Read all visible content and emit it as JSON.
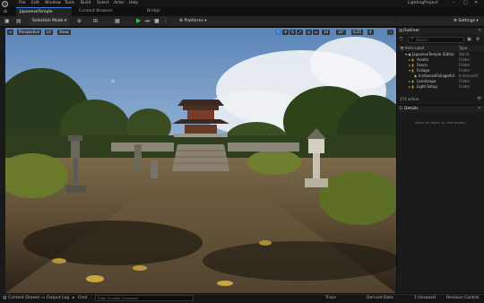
{
  "menu": {
    "items": [
      "File",
      "Edit",
      "Window",
      "Tools",
      "Build",
      "Select",
      "Actor",
      "Help"
    ],
    "project_name": "LightingProject"
  },
  "tabs": {
    "level": "JapaneseTemple",
    "content_browser": "Content Browser",
    "bridge": "Bridge"
  },
  "toolbar": {
    "selection_mode": "Selection Mode",
    "platforms": "Platforms",
    "settings": "Settings"
  },
  "viewport": {
    "perspective": "Perspective",
    "lit": "Lit",
    "show": "Show",
    "grid_snap": "10",
    "rotation_snap": "10°",
    "scale_snap": "0.25",
    "camera_speed": "4"
  },
  "outliner": {
    "title": "Outliner",
    "search_placeholder": "Search",
    "col_label": "Item Label",
    "col_type": "Type",
    "rows": [
      {
        "label": "JapaneseTemple (Editor",
        "type": "World",
        "indent": 0
      },
      {
        "label": "Assets",
        "type": "Folder",
        "indent": 1
      },
      {
        "label": "Fence",
        "type": "Folder",
        "indent": 1
      },
      {
        "label": "Foliage",
        "type": "Folder",
        "indent": 1
      },
      {
        "label": "InstancedFoliageAct",
        "type": "InstancedF",
        "indent": 2
      },
      {
        "label": "Landscape",
        "type": "Folder",
        "indent": 1
      },
      {
        "label": "Light Setup",
        "type": "Folder",
        "indent": 1
      }
    ],
    "actor_count": "174 actors"
  },
  "details": {
    "title": "Details",
    "empty_message": "Select an object to view details."
  },
  "statusbar": {
    "content_drawer": "Content Drawer",
    "output_log": "Output Log",
    "cmd": "Cmd",
    "cmd_placeholder": "Enter Console Command",
    "trace": "Trace",
    "derived_data": "Derived Data",
    "unsaved": "1 Unsaved",
    "revision_control": "Revision Control"
  },
  "colors": {
    "accent": "#3a7bd5",
    "play_green": "#3fbf4a",
    "folder": "#c9a04e"
  }
}
